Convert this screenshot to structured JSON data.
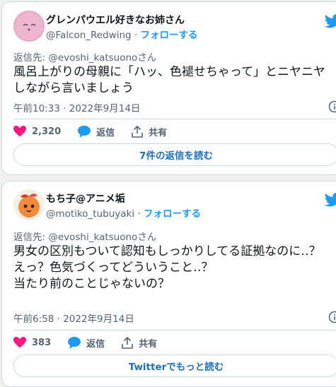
{
  "tweets": [
    {
      "display_name": "グレンパウエル好きなお姉さん",
      "handle": "@Falcon_Redwing",
      "separator": "·",
      "follow_label": "フォローする",
      "reply_to_prefix": "返信先: ",
      "reply_to_handle": "@evoshi_katsuono",
      "reply_to_suffix": "さん",
      "body": "風呂上がりの母親に「ハッ、色褪せちゃって」とニヤニヤしながら言いましょう",
      "timestamp": "午前10:33 · 2022年9月14日",
      "likes": "2,320",
      "reply_label": "返信",
      "share_label": "共有",
      "read_more_label": "7件の返信を読む",
      "avatar_icon": "pink-face-avatar"
    },
    {
      "display_name": "もち子@アニメ垢",
      "handle": "@motiko_tubuyaki",
      "separator": "·",
      "follow_label": "フォローする",
      "reply_to_prefix": "返信先: ",
      "reply_to_handle": "@evoshi_katsuono",
      "reply_to_suffix": "さん",
      "body": "男女の区別もついて認知もしっかりしてる証拠なのに‥？\nえっ？色気づくってどういうこと‥？\n当たり前のことじゃないの？",
      "timestamp": "午前6:58 · 2022年9月14日",
      "likes": "383",
      "reply_label": "返信",
      "share_label": "共有",
      "read_more_label": "Twitterでもっと読む",
      "avatar_icon": "peach-character-avatar"
    }
  ],
  "icons": {
    "like": "heart-icon",
    "reply": "speech-bubble-icon",
    "share": "share-upload-icon",
    "brand": "twitter-bird-icon",
    "info": "info-icon"
  },
  "colors": {
    "brand_blue": "#1d9bf0",
    "like_pink": "#f91880",
    "text_primary": "#0f1419",
    "text_secondary": "#536471",
    "border": "#cfd9de"
  }
}
